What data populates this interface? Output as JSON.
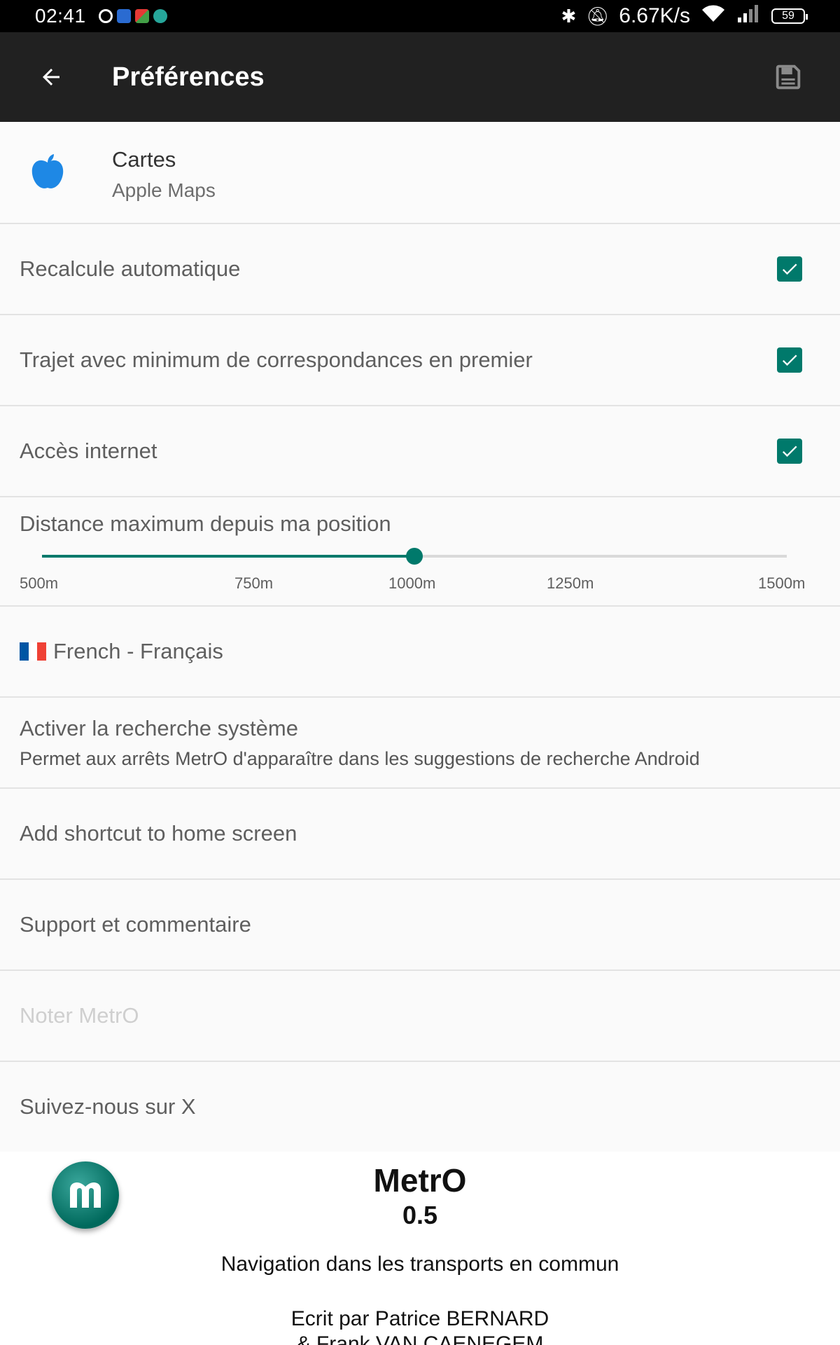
{
  "status_bar": {
    "time": "02:41",
    "speed": "6.67K/s",
    "battery": "59"
  },
  "app_bar": {
    "title": "Préférences",
    "back_icon": "arrow-left-icon",
    "save_icon": "floppy-disk-icon"
  },
  "settings": {
    "maps": {
      "title": "Cartes",
      "value": "Apple Maps",
      "icon": "apple-icon"
    },
    "auto_recalc": {
      "label": "Recalcule automatique",
      "checked": true
    },
    "min_transfers": {
      "label": "Trajet avec minimum de correspondances en premier",
      "checked": true
    },
    "internet": {
      "label": "Accès internet",
      "checked": true
    },
    "distance": {
      "label": "Distance maximum depuis ma position",
      "ticks": [
        "500m",
        "750m",
        "1000m",
        "1250m",
        "1500m"
      ],
      "min": 500,
      "max": 1500,
      "value": 1000
    },
    "language": {
      "label": "French - Français",
      "flag_colors": [
        "#0055a4",
        "#ffffff",
        "#ef4135"
      ]
    },
    "system_search": {
      "label": "Activer la recherche système",
      "description": "Permet aux arrêts MetrO d'apparaître dans les suggestions de recherche Android"
    },
    "shortcut": {
      "label": "Add shortcut to home screen"
    },
    "support": {
      "label": "Support et commentaire"
    },
    "rate": {
      "label": "Noter MetrO",
      "enabled": false
    },
    "follow": {
      "label": "Suivez-nous sur X"
    }
  },
  "about": {
    "app_name": "MetrO",
    "version": "0.5",
    "description": "Navigation dans les transports en commun",
    "author_line1": "Ecrit par Patrice BERNARD",
    "author_line2": "& Frank VAN CAENEGEM"
  },
  "colors": {
    "accent": "#00796b",
    "app_bar": "#212121",
    "apple_blue": "#1e88e5"
  }
}
